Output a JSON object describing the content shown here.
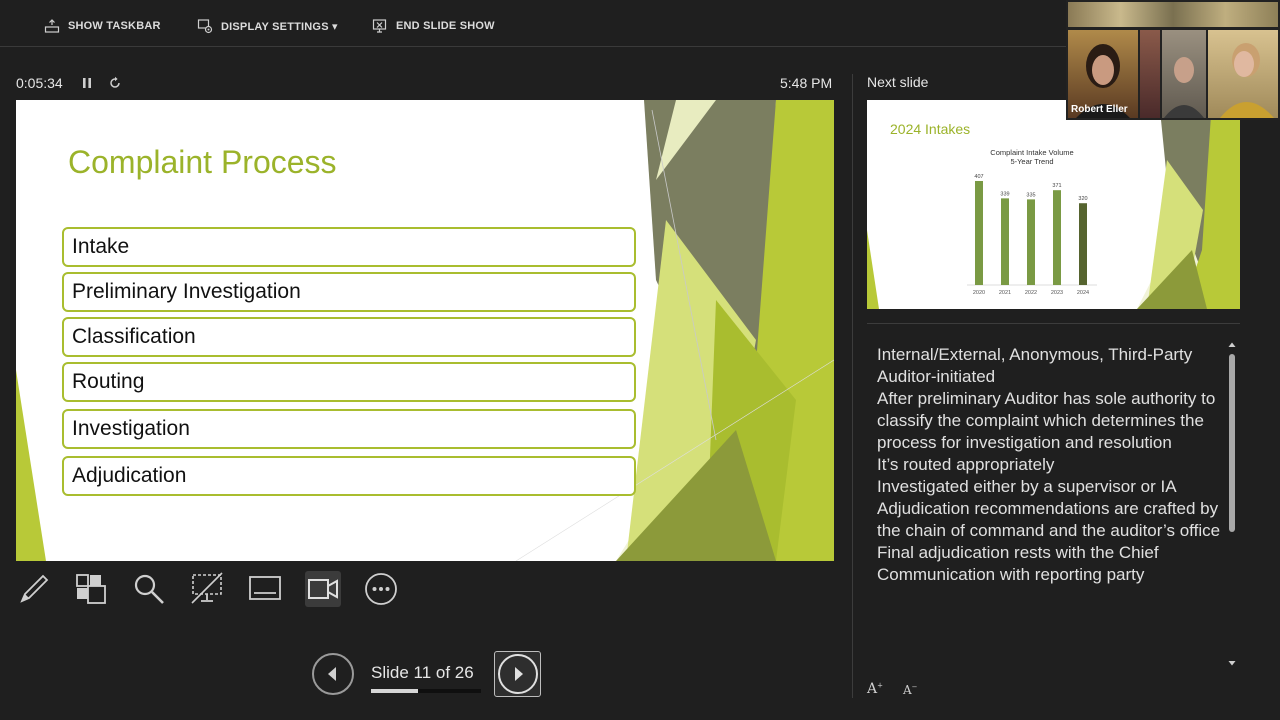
{
  "toolbar": {
    "show_taskbar": "SHOW TASKBAR",
    "display_settings": "DISPLAY SETTINGS ▾",
    "end_slide_show": "END SLIDE SHOW"
  },
  "status": {
    "timer": "0:05:34",
    "clock": "5:48 PM"
  },
  "current_slide": {
    "title": "Complaint Process",
    "steps": [
      "Intake",
      "Preliminary Investigation",
      "Classification",
      "Routing",
      "Investigation",
      "Adjudication"
    ]
  },
  "navigation": {
    "slide_counter": "Slide 11 of 26",
    "progress": 0.423
  },
  "next_slide": {
    "label": "Next slide",
    "title": "2024 Intakes",
    "chart_title_line1": "Complaint Intake Volume",
    "chart_title_line2": "5-Year Trend"
  },
  "chart_data": {
    "type": "bar",
    "title": "Complaint Intake Volume 5-Year Trend",
    "categories": [
      "2020",
      "2021",
      "2022",
      "2023",
      "2024"
    ],
    "values": [
      407,
      339,
      335,
      371,
      320
    ],
    "ylim": [
      0,
      450
    ],
    "colors": [
      "#7a9a44",
      "#7a9a44",
      "#7a9a44",
      "#7a9a44",
      "#56642f"
    ]
  },
  "notes": [
    "Internal/External, Anonymous, Third-Party",
    "Auditor-initiated",
    "After preliminary Auditor has sole authority to classify the complaint which determines the process for investigation and resolution",
    "It’s routed appropriately",
    "Investigated either by a supervisor or IA",
    "Adjudication recommendations are crafted by the chain of command and the auditor’s office",
    "Final adjudication rests with the Chief",
    "Communication with reporting party"
  ],
  "notes_controls": {
    "font_increase": "A",
    "font_decrease": "A"
  },
  "video": {
    "participant_name": "Robert Eller"
  },
  "colors": {
    "accent_green": "#9bb32a",
    "background": "#1f1f1f"
  }
}
